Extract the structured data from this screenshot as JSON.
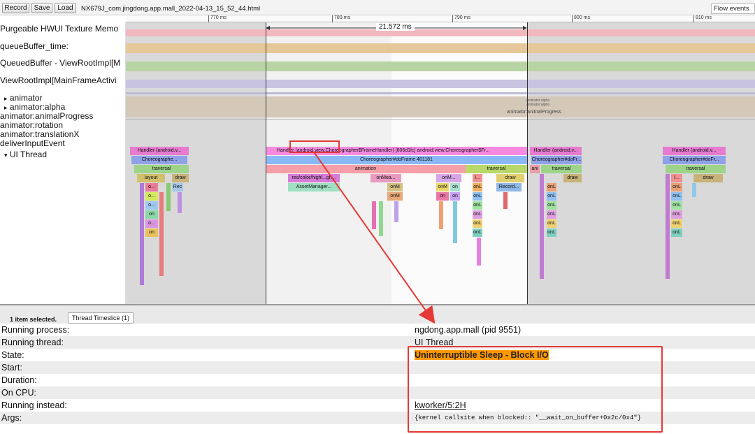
{
  "toolbar": {
    "record": "Record",
    "save": "Save",
    "load": "Load",
    "filename": "NX679J_com.jingdong.app.mall_2022-04-13_15_52_44.html",
    "flow_events": "Flow events"
  },
  "ruler": {
    "ticks": [
      "770 ms",
      "780 ms",
      "790 ms",
      "800 ms",
      "810 ms"
    ],
    "measure": "21.572 ms"
  },
  "tracks": {
    "labels": [
      "Purgeable HWUI Texture Memo",
      "queueBuffer_time:",
      "QueuedBuffer - ViewRootImpl[M",
      "ViewRootImpl[MainFrameActivi",
      "animator",
      "animator:alpha",
      "animator:animalProgress",
      "animator:rotation",
      "animator:translationX",
      "deliverInputEvent",
      "UI Thread"
    ],
    "expand_glyph": "▸",
    "collapse_glyph": "▾",
    "inline_labels": [
      "animator:alpha",
      "animator:alpha",
      "animator:animalProgress"
    ],
    "slices": {
      "handler1": "Handler (android.v...",
      "choreo1": "Choreographe...",
      "traversal": "traversal",
      "layout": "layout",
      "draw": "draw",
      "rec": "Rec",
      "handler_main": "Handler (android.view.Choreographer$FrameHandler) [806d1fc] android.view.Choreographer$Fr...",
      "doframe": "Choreographer#doFrame 481181",
      "animation": "animation",
      "res": "res/color/highl...gh...",
      "asset": "AssetManager...",
      "onmea": "onMea...",
      "onm": "onM",
      "onmdots": "onM...",
      "onl": "onL",
      "l": "l...",
      "record": "Record...",
      "ani": "ani",
      "handler2": "Handler (android.v...",
      "choreo2": "Choreographer#doFr...",
      "handler3": "Handler (android.v...",
      "choreo3": "Choreographer#doFr...",
      "o": "o...",
      "on": "on",
      "i": "I..."
    }
  },
  "selection": {
    "count": "1 item selected.",
    "tab": "Thread Timeslice (1)"
  },
  "details": [
    {
      "key": "Running process:",
      "value": "ngdong.app.mall (pid 9551)"
    },
    {
      "key": "Running thread:",
      "value": "UI Thread"
    },
    {
      "key": "State:",
      "value": "Uninterruptible Sleep - Block I/O"
    },
    {
      "key": "Start:",
      "value": ""
    },
    {
      "key": "Duration:",
      "value": ""
    },
    {
      "key": "On CPU:",
      "value": ""
    },
    {
      "key": "Running instead:",
      "value": "kworker/5:2H"
    },
    {
      "key": "Args:",
      "value": "{kernel callsite when blocked:: \"__wait_on_buffer+0x2c/0x4\"}"
    }
  ],
  "colors": {
    "state_highlight": "#ff9800",
    "annotation": "#e53935"
  }
}
